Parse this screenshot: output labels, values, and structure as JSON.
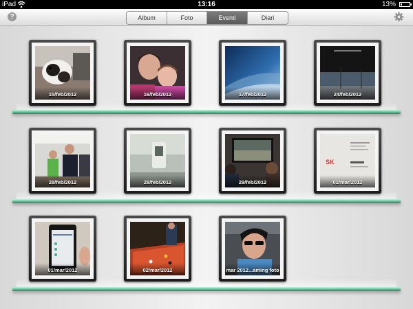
{
  "status_bar": {
    "carrier": "iPad",
    "time": "13:16",
    "battery_percent": "13%",
    "battery_level": 0.13
  },
  "toolbar": {
    "help_label": "?",
    "tabs": [
      {
        "label": "Album",
        "active": false
      },
      {
        "label": "Foto",
        "active": false
      },
      {
        "label": "Eventi",
        "active": true
      },
      {
        "label": "Diari",
        "active": false
      }
    ],
    "settings_icon": "gear-icon"
  },
  "events": [
    {
      "date": "15/feb/2012",
      "photo": "dog"
    },
    {
      "date": "16/feb/2012",
      "photo": "people"
    },
    {
      "date": "17/feb/2012",
      "photo": "blue-wallpaper"
    },
    {
      "date": "24/feb/2012",
      "photo": "dark-street"
    },
    {
      "date": "28/feb/2012",
      "photo": "office-people"
    },
    {
      "date": "28/feb/2012",
      "photo": "blurry-device"
    },
    {
      "date": "29/feb/2012",
      "photo": "monitor-meeting"
    },
    {
      "date": "01/mar/2012",
      "photo": "business-card"
    },
    {
      "date": "01/mar/2012",
      "photo": "phone-screen"
    },
    {
      "date": "02/mar/2012",
      "photo": "pool-table"
    },
    {
      "date": "mar 2012...aming foto",
      "photo": "selfie-car"
    }
  ],
  "colors": {
    "shelf": "#57b990",
    "active_tab": "#6b6b6b",
    "status_bar": "#000000"
  }
}
